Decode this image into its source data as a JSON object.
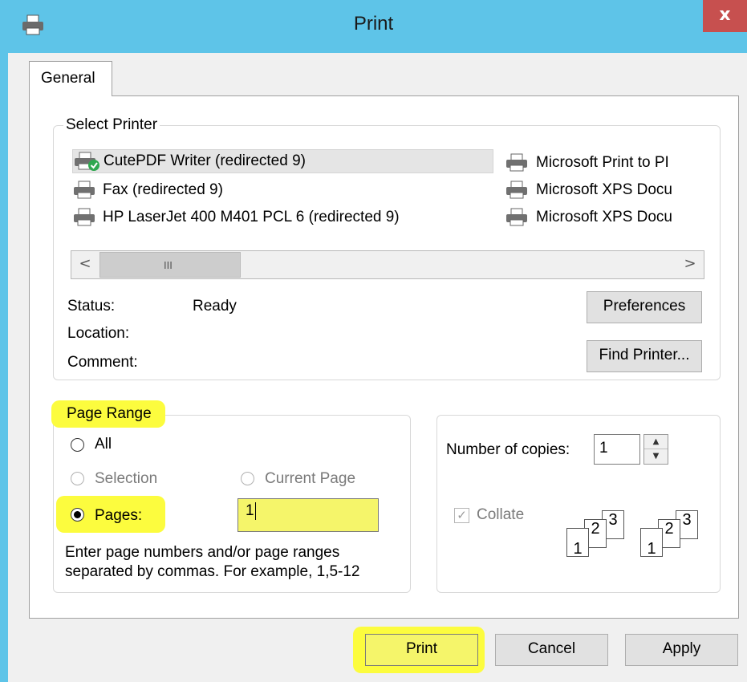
{
  "window": {
    "title": "Print",
    "close_glyph": "x",
    "icon": "printer-icon"
  },
  "tabs": [
    {
      "label": "General",
      "active": true
    }
  ],
  "select_printer": {
    "group_label": "Select Printer",
    "printers": [
      {
        "name": "CutePDF Writer (redirected 9)",
        "selected": true,
        "default": true
      },
      {
        "name": "Fax (redirected 9)"
      },
      {
        "name": "HP LaserJet 400 M401 PCL 6 (redirected 9)"
      },
      {
        "name": "Microsoft Print to PI"
      },
      {
        "name": "Microsoft XPS Docu"
      },
      {
        "name": "Microsoft XPS Docu"
      }
    ],
    "scrollbar": {
      "left_glyph": "<",
      "right_glyph": ">",
      "grip": "III"
    },
    "status_label": "Status:",
    "status_value": "Ready",
    "location_label": "Location:",
    "comment_label": "Comment:",
    "preferences_label": "Preferences",
    "find_printer_label": "Find Printer..."
  },
  "page_range": {
    "group_label": "Page Range",
    "all_label": "All",
    "selection_label": "Selection",
    "current_page_label": "Current Page",
    "pages_label": "Pages:",
    "pages_value": "1",
    "hint_line1": "Enter page numbers and/or page ranges",
    "hint_line2": "separated by commas.  For example, 1,5-12",
    "selected_option": "pages"
  },
  "copies": {
    "label": "Number of copies:",
    "value": "1",
    "collate_label": "Collate",
    "collate_checked": true,
    "collate_pages": [
      "1",
      "2",
      "3"
    ]
  },
  "buttons": {
    "print_label": "Print",
    "cancel_label": "Cancel",
    "apply_label": "Apply"
  },
  "highlight_color": "#fcfc3e",
  "titlebar_color": "#5ec4e8"
}
